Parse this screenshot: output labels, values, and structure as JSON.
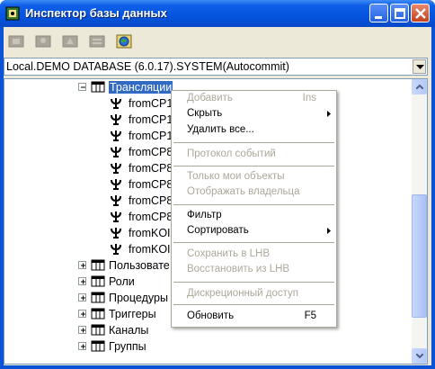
{
  "window": {
    "title": "Инспектор базы данных"
  },
  "toolbar": {
    "tools": [
      "new-object-icon",
      "user-icon",
      "notify-icon",
      "object-list-icon",
      "db-globe-icon"
    ]
  },
  "db_selector": {
    "value": "Local.DEMO DATABASE (6.0.17).SYSTEM(Autocommit)"
  },
  "tree": {
    "translations": {
      "label": "Трансляции",
      "children": [
        "fromCP1",
        "fromCP1",
        "fromCP1",
        "fromCP8",
        "fromCP8",
        "fromCP8",
        "fromCP8",
        "fromCP8",
        "fromKOI",
        "fromKOI"
      ]
    },
    "folders": [
      "Пользовате",
      "Роли",
      "Процедуры",
      "Триггеры",
      "Каналы",
      "Группы"
    ]
  },
  "context_menu": {
    "add": {
      "label": "Добавить",
      "shortcut": "Ins"
    },
    "hide": "Скрыть",
    "delete_all": "Удалить все...",
    "event_log": "Протокол событий",
    "my_objects_only": "Только мои объекты",
    "show_owner": "Отображать владельца",
    "filter": "Фильтр",
    "sort": "Сортировать",
    "save_lhb": "Сохранить в LHB",
    "restore_lhb": "Восстановить из LHB",
    "discretionary_access": "Дискреционный доступ",
    "refresh": {
      "label": "Обновить",
      "shortcut": "F5"
    }
  }
}
